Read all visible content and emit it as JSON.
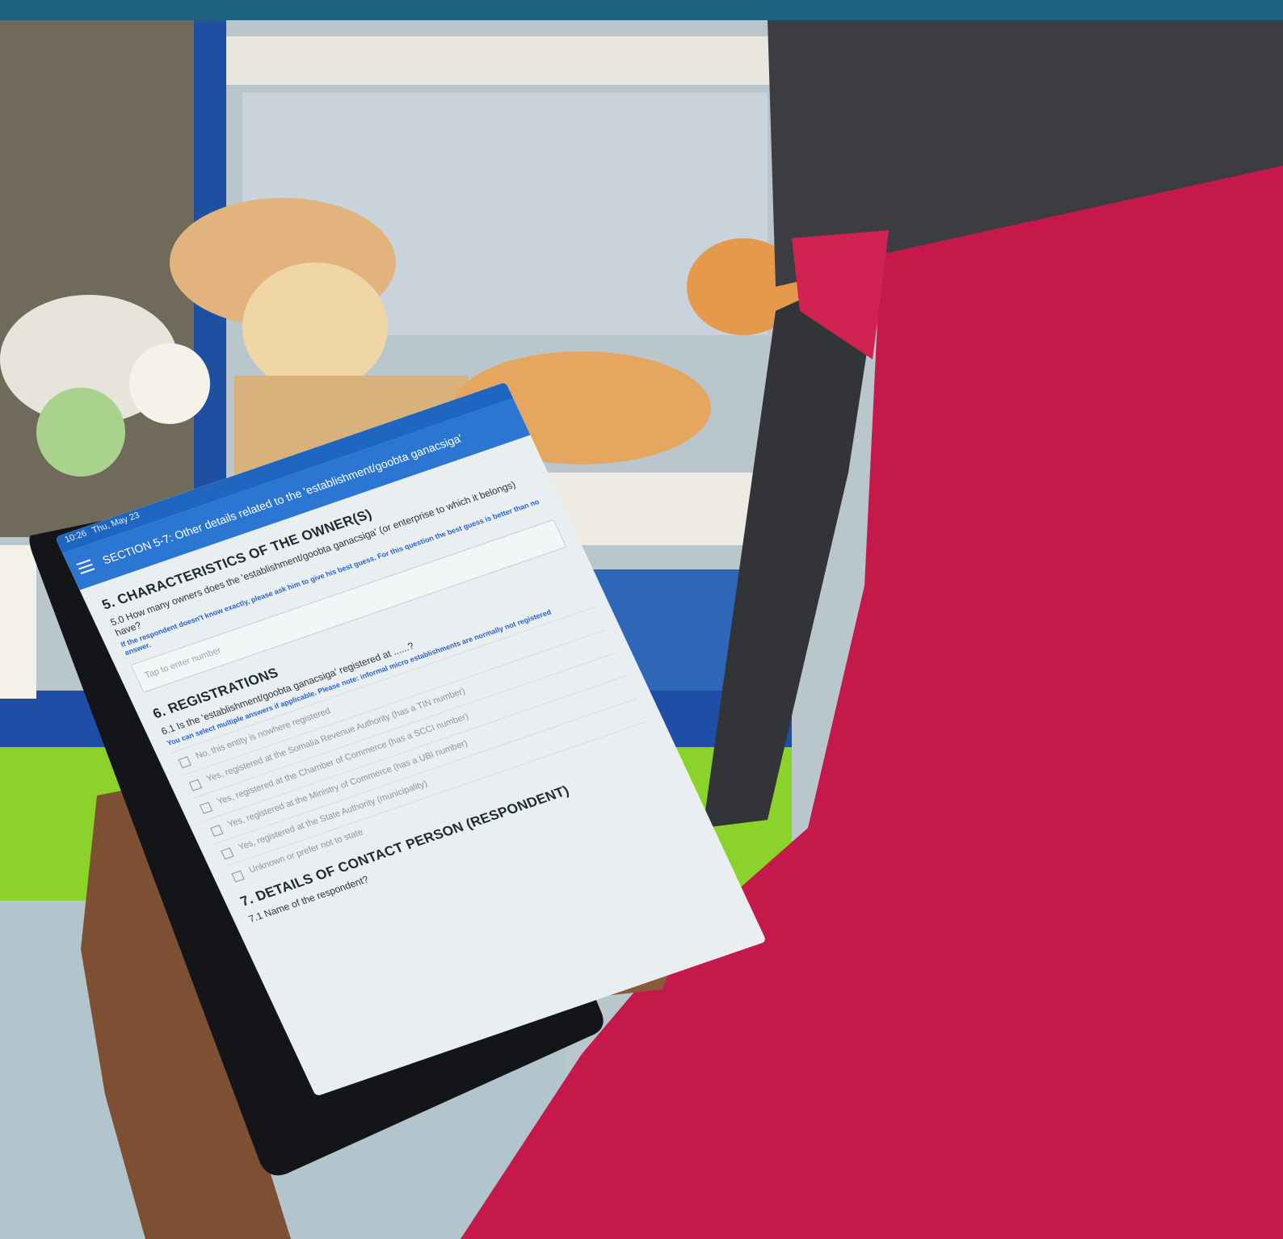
{
  "tablet": {
    "status_bar": {
      "time": "10:26",
      "date": "Thu, May 23"
    },
    "app_bar": {
      "title": "SECTION 5-7: Other details related to the 'establishment/goobta ganacsiga'"
    },
    "section5": {
      "title": "5. CHARACTERISTICS OF THE OWNER(S)",
      "question": "5.0 How many owners does the 'establishment/goobta ganacsiga' (or enterprise to which it belongs) have?",
      "hint": "If the respondent doesn't know exactly, please ask him to give his best guess. For this question the best guess is better than no answer.",
      "input_placeholder": "Tap to enter number"
    },
    "section6": {
      "title": "6. REGISTRATIONS",
      "question": "6.1 Is the 'establishment/goobta ganacsiga' registered at ......?",
      "hint": "You can select multiple answers if applicable. Please note: informal micro establishments are normally not registered",
      "options": [
        "No, this entity is nowhere registered",
        "Yes, registered at the Somalia Revenue Authority (has a TIN number)",
        "Yes, registered at the Chamber of Commerce (has a SCCI number)",
        "Yes, registered at the Ministry of Commerce (has a UBI number)",
        "Yes, registered at the State Authority (municipality)",
        "Unknown or prefer not to state"
      ]
    },
    "section7": {
      "title": "7. DETAILS OF CONTACT PERSON (RESPONDENT)",
      "question": "7.1 Name of the respondent?"
    }
  },
  "colors": {
    "top_band": "#1c6180",
    "tablet_accent": "#2b76d2",
    "garment": "#c5194b",
    "veil": "#3c3d40"
  }
}
